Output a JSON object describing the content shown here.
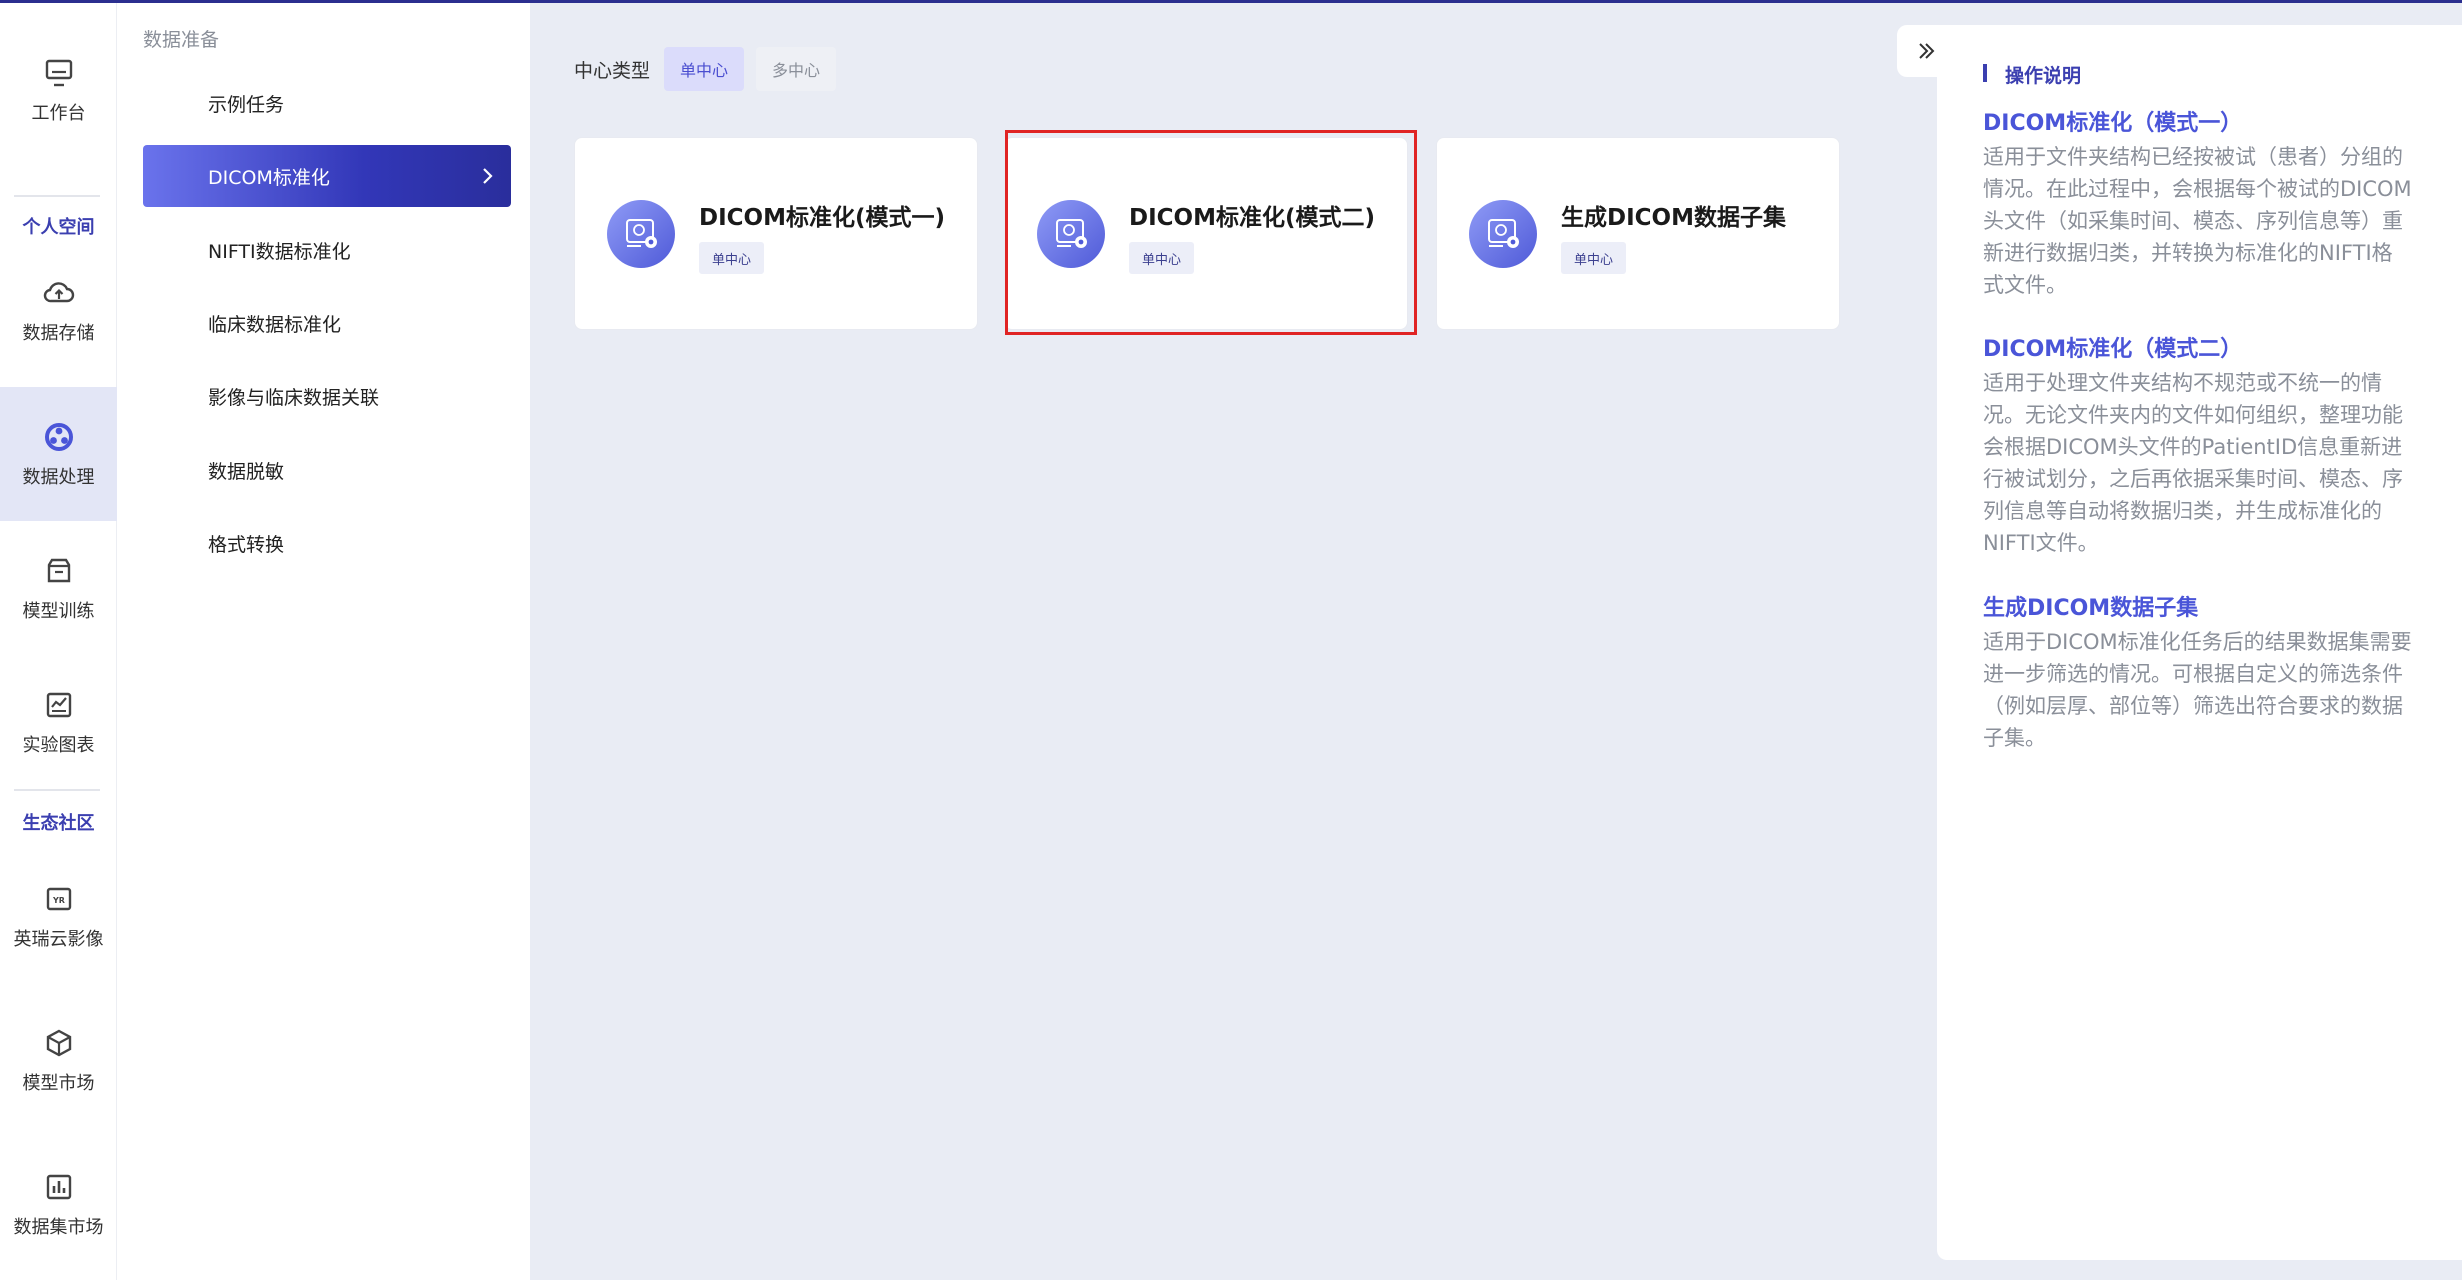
{
  "rail": {
    "workbench": "工作台",
    "personal_space": "个人空间",
    "data_storage": "数据存储",
    "data_processing": "数据处理",
    "model_training": "模型训练",
    "experiment_charts": "实验图表",
    "eco_community": "生态社区",
    "yingrui_cloud": "英瑞云影像",
    "model_market": "模型市场",
    "dataset_market": "数据集市场"
  },
  "submenu": {
    "title": "数据准备",
    "items": [
      {
        "label": "示例任务"
      },
      {
        "label": "DICOM标准化"
      },
      {
        "label": "NIFTI数据标准化"
      },
      {
        "label": "临床数据标准化"
      },
      {
        "label": "影像与临床数据关联"
      },
      {
        "label": "数据脱敏"
      },
      {
        "label": "格式转换"
      }
    ]
  },
  "filter": {
    "label": "中心类型",
    "options": [
      "单中心",
      "多中心"
    ]
  },
  "cards": [
    {
      "title": "DICOM标准化(模式一)",
      "tag": "单中心"
    },
    {
      "title": "DICOM标准化(模式二)",
      "tag": "单中心"
    },
    {
      "title": "生成DICOM数据子集",
      "tag": "单中心"
    }
  ],
  "help": {
    "title": "操作说明",
    "sections": [
      {
        "heading": "DICOM标准化（模式一）",
        "text": "适用于文件夹结构已经按被试（患者）分组的情况。在此过程中，会根据每个被试的DICOM头文件（如采集时间、模态、序列信息等）重新进行数据归类，并转换为标准化的NIFTI格式文件。"
      },
      {
        "heading": "DICOM标准化（模式二）",
        "text": "适用于处理文件夹结构不规范或不统一的情况。无论文件夹内的文件如何组织，整理功能会根据DICOM头文件的PatientID信息重新进行被试划分，之后再依据采集时间、模态、序列信息等自动将数据归类，并生成标准化的NIFTI文件。"
      },
      {
        "heading": "生成DICOM数据子集",
        "text": "适用于DICOM标准化任务后的结果数据集需要进一步筛选的情况。可根据自定义的筛选条件（例如层厚、部位等）筛选出符合要求的数据子集。"
      }
    ]
  },
  "colors": {
    "accent": "#3b3fb0",
    "active_menu_start": "#6a73ec",
    "active_menu_end": "#2a2e9c",
    "highlight_frame": "#e02424",
    "help_heading": "#4a55d8"
  }
}
